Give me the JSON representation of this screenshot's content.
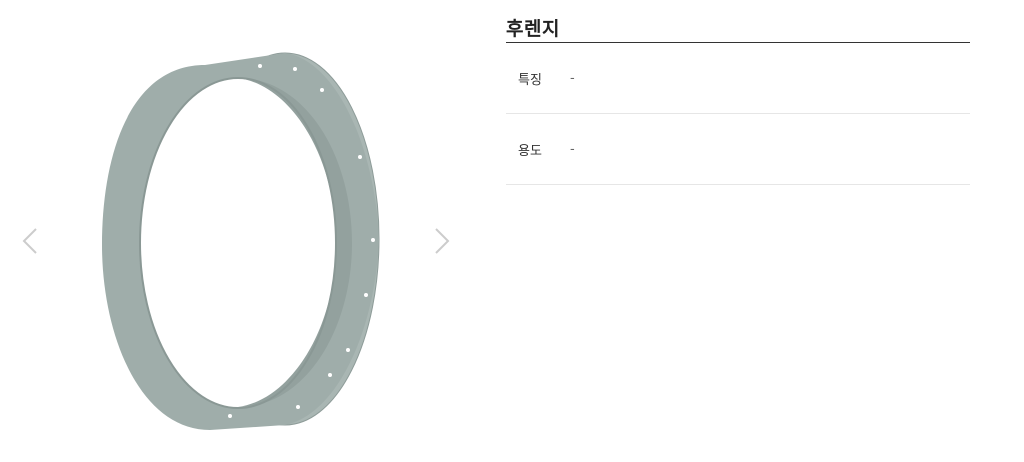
{
  "product": {
    "title": "후렌지",
    "image_icon": "flange-ring-icon",
    "specs": [
      {
        "label": "특징",
        "value": "-"
      },
      {
        "label": "용도",
        "value": "-"
      }
    ]
  },
  "gallery": {
    "prev_icon": "chevron-left-icon",
    "next_icon": "chevron-right-icon"
  },
  "colors": {
    "flange": "#9fadaa",
    "arrow": "#cccccc",
    "title_rule": "#333333",
    "row_rule": "#e6e6e6"
  }
}
